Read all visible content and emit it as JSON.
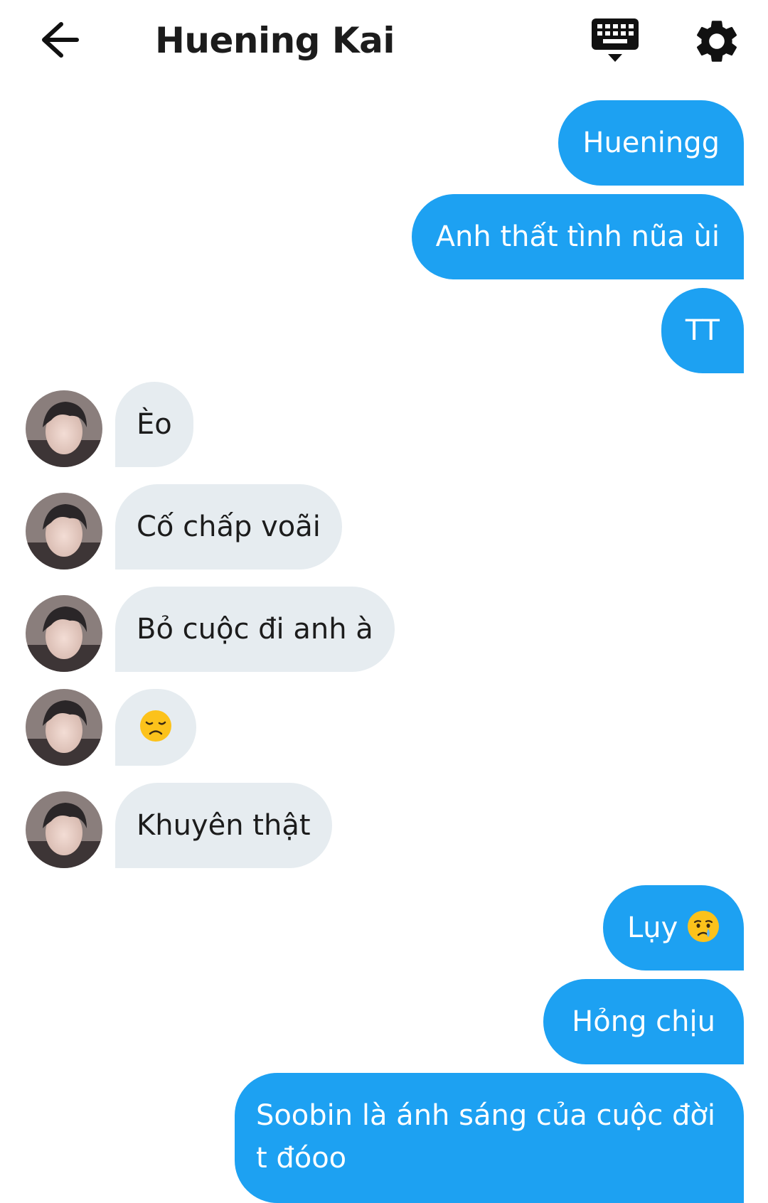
{
  "header": {
    "title": "Huening Kai",
    "back_icon": "arrow-left-icon",
    "keyboard_icon": "keyboard-icon",
    "settings_icon": "gear-icon"
  },
  "colors": {
    "outgoing_bubble": "#1da1f2",
    "incoming_bubble": "#e6ecf0",
    "text_dark": "#1c1c1c"
  },
  "messages": [
    {
      "dir": "out",
      "text": "Hueningg"
    },
    {
      "dir": "out",
      "text": "Anh thất tình nũa ùi"
    },
    {
      "dir": "out",
      "text": "TT"
    },
    {
      "dir": "in",
      "text": "Èo"
    },
    {
      "dir": "in",
      "text": "Cố chấp voãi"
    },
    {
      "dir": "in",
      "text": "Bỏ cuộc đi anh à"
    },
    {
      "dir": "in",
      "emoji": "disappointed-face-emoji"
    },
    {
      "dir": "in",
      "text": "Khuyên thật"
    },
    {
      "dir": "out",
      "text": "Lụy",
      "emoji": "crying-face-emoji"
    },
    {
      "dir": "out",
      "text": "Hỏng chịu"
    },
    {
      "dir": "out",
      "text_line1": "Soobin là ánh sáng của cuộc đời",
      "text_line2": "t đóoo"
    }
  ]
}
